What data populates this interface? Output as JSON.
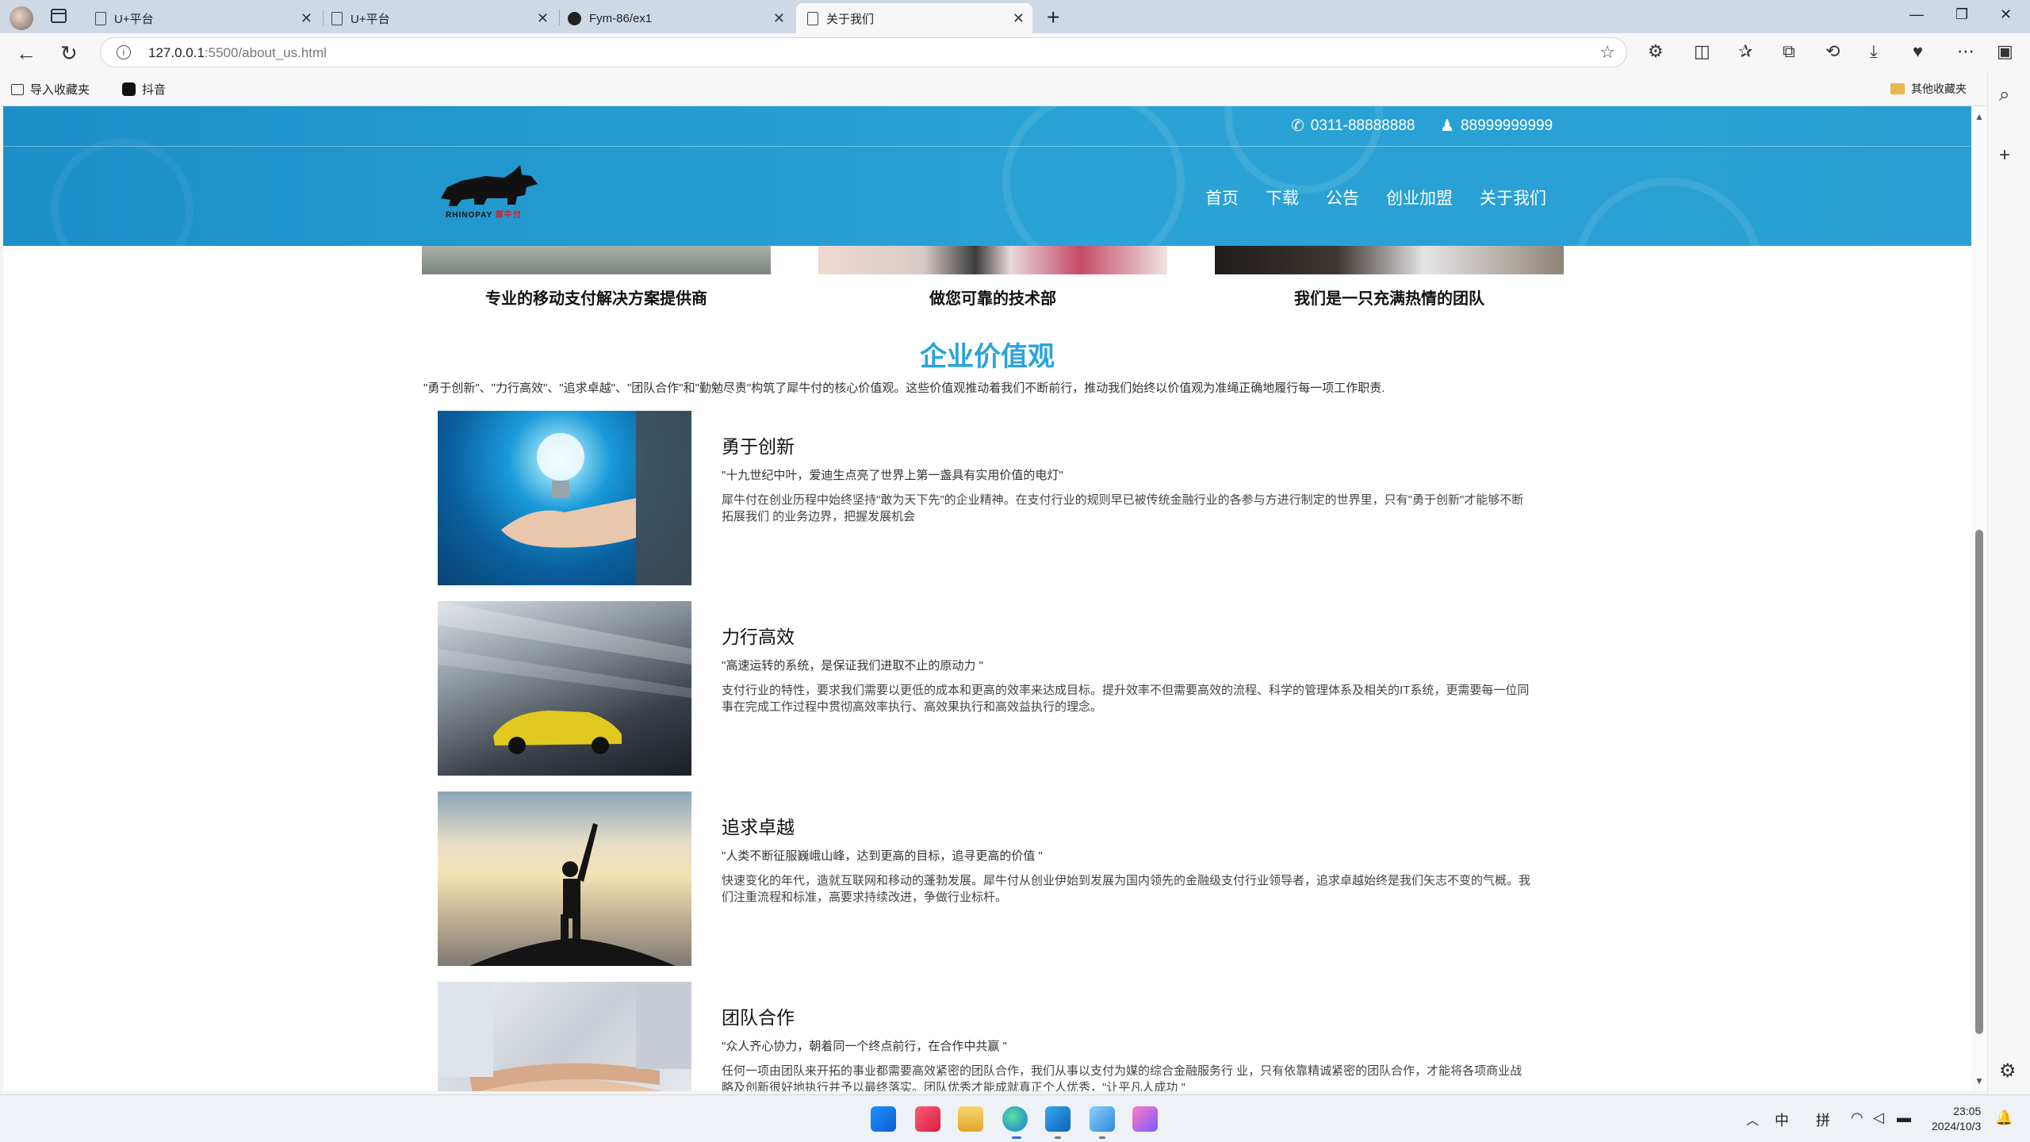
{
  "browser": {
    "tabs": [
      {
        "title": "U+平台",
        "icon": "page-icon"
      },
      {
        "title": "U+平台",
        "icon": "page-icon"
      },
      {
        "title": "Fym-86/ex1",
        "icon": "github-icon"
      },
      {
        "title": "关于我们",
        "icon": "page-icon",
        "active": true
      }
    ],
    "url_host": "127.0.0.1",
    "url_rest": ":5500/about_us.html",
    "bookmarks": [
      {
        "label": "导入收藏夹"
      },
      {
        "label": "抖音"
      }
    ],
    "other_bookmarks": "其他收藏夹"
  },
  "site": {
    "phone": "0311-88888888",
    "qq": "88999999999",
    "logo_en": "RHINOPAY",
    "logo_cn": "犀牛付",
    "nav": [
      "首页",
      "下载",
      "公告",
      "创业加盟",
      "关于我们"
    ],
    "cards": [
      "专业的移动支付解决方案提供商",
      "做您可靠的技术部",
      "我们是一只充满热情的团队"
    ],
    "values_title": "企业价值观",
    "values_intro": "\"勇于创新\"、\"力行高效\"、\"追求卓越\"、\"团队合作\"和\"勤勉尽责\"构筑了犀牛付的核心价值观。这些价值观推动着我们不断前行，推动我们始终以价值观为准绳正确地履行每一项工作职责.",
    "values": [
      {
        "name": "勇于创新",
        "quote": "\"十九世纪中叶，爱迪生点亮了世界上第一盏具有实用价值的电灯\"",
        "desc": "犀牛付在创业历程中始终坚持\"敢为天下先\"的企业精神。在支付行业的规则早已被传统金融行业的各参与方进行制定的世界里，只有\"勇于创新\"才能够不断拓展我们 的业务边界，把握发展机会"
      },
      {
        "name": "力行高效",
        "quote": "\"高速运转的系统，是保证我们进取不止的原动力 \"",
        "desc": "支付行业的特性，要求我们需要以更低的成本和更高的效率来达成目标。提升效率不但需要高效的流程、科学的管理体系及相关的IT系统，更需要每一位同事在完成工作过程中贯彻高效率执行、高效果执行和高效益执行的理念。"
      },
      {
        "name": "追求卓越",
        "quote": "\"人类不断征服巍峨山峰，达到更高的目标，追寻更高的价值 \"",
        "desc": "快速变化的年代，造就互联网和移动的蓬勃发展。犀牛付从创业伊始到发展为国内领先的金融级支付行业领导者，追求卓越始终是我们矢志不变的气概。我们注重流程和标准，高要求持续改进，争做行业标杆。"
      },
      {
        "name": "团队合作",
        "quote": "\"众人齐心协力，朝着同一个终点前行，在合作中共赢 \"",
        "desc": "任何一项由团队来开拓的事业都需要高效紧密的团队合作，我们从事以支付为媒的综合金融服务行 业，只有依靠精诚紧密的团队合作，才能将各项商业战略及创新很好地执行并予以最终落实。团队优秀才能成就真正个人优秀，\"让平凡人成功 \""
      }
    ]
  },
  "taskbar": {
    "ime_lang": "中",
    "ime_mode": "拼",
    "time": "23:05",
    "date": "2024/10/3"
  },
  "colors": {
    "header_blue": "#2aa3d6",
    "values_title": "#2aa3dd"
  }
}
